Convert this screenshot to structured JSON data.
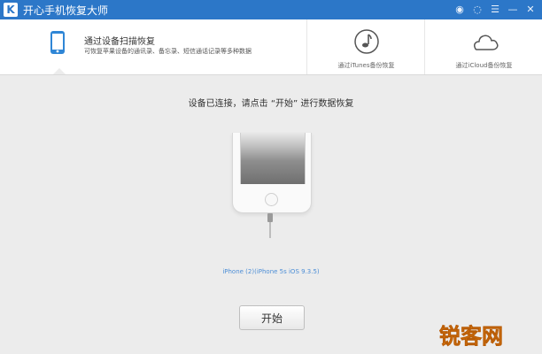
{
  "app": {
    "logo_text": "K",
    "title": "开心手机恢复大师"
  },
  "window_controls": [
    {
      "name": "wechat-icon",
      "glyph": "◉"
    },
    {
      "name": "skin-icon",
      "glyph": "◌"
    },
    {
      "name": "menu-icon",
      "glyph": "☰"
    },
    {
      "name": "minimize-icon",
      "glyph": "—"
    },
    {
      "name": "close-icon",
      "glyph": "✕"
    }
  ],
  "nav": {
    "tab1": {
      "title": "通过设备扫描恢复",
      "desc": "可恢复苹果设备的通讯录、备忘录、短信通话记录等多种数据"
    },
    "tab2": {
      "label": "通过iTunes备份恢复"
    },
    "tab3": {
      "label": "通过iCloud备份恢复"
    }
  },
  "main": {
    "status": "设备已连接，请点击 “开始” 进行数据恢复",
    "device_info": "iPhone (2)(iPhone 5s iOS 9.3.5)",
    "start_label": "开始"
  },
  "watermark": {
    "text": "锐客网"
  }
}
